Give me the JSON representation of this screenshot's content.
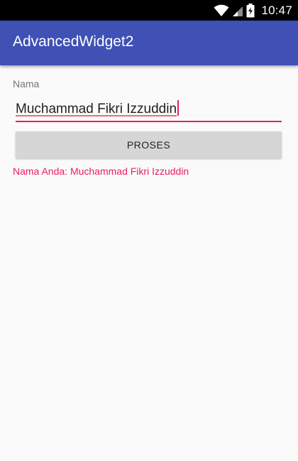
{
  "status_bar": {
    "time": "10:47",
    "icons": [
      "wifi-icon",
      "signal-icon",
      "battery-charging-icon"
    ]
  },
  "app_bar": {
    "title": "AdvancedWidget2",
    "color": "#3f51b5"
  },
  "form": {
    "name_label": "Nama",
    "name_value": "Muchammad Fikri Izzuddin",
    "accent_color": "#e91e63",
    "button_label": "PROSES",
    "result_text": "Nama Anda: Muchammad Fikri Izzuddin"
  }
}
